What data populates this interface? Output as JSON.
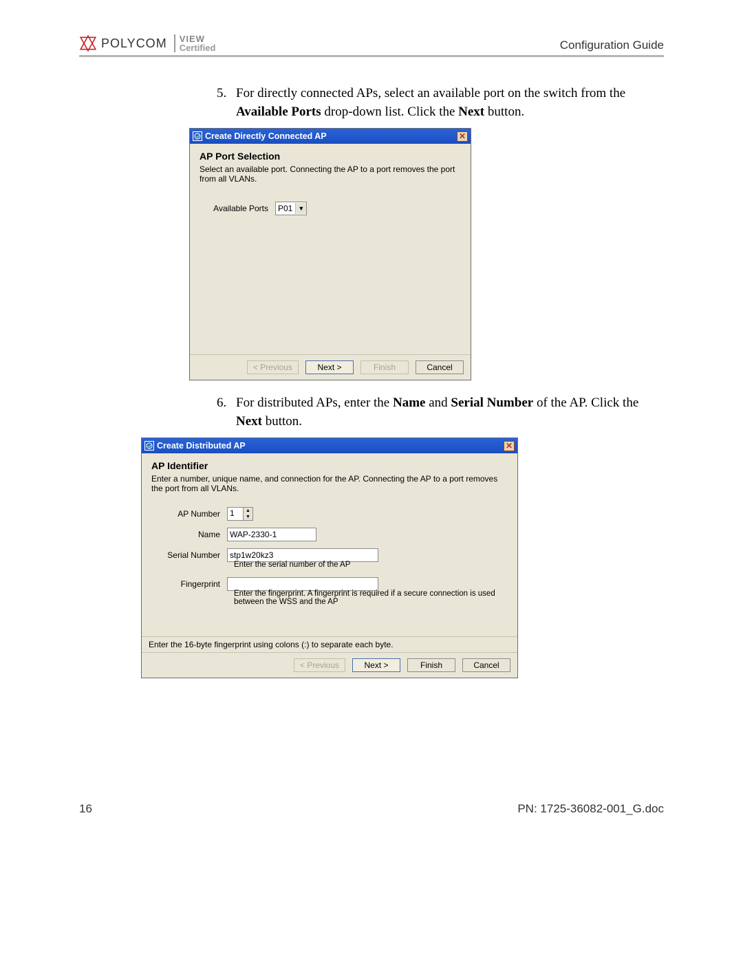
{
  "header": {
    "brand": "POLYCOM",
    "viewL1": "VIEW",
    "viewL2": "Certified",
    "title": "Configuration Guide"
  },
  "steps": {
    "s5": {
      "num": "5.",
      "text_a": "For directly connected APs, select an available port on the switch from the ",
      "bold_a": "Available Ports",
      "text_b": " drop-down list. Click the ",
      "bold_b": "Next",
      "text_c": " button."
    },
    "s6": {
      "num": "6.",
      "text_a": "For distributed APs, enter the ",
      "bold_a": "Name",
      "text_mid": " and ",
      "bold_b": "Serial Number",
      "text_b": " of the AP. Click the ",
      "bold_c": "Next",
      "text_c": " button."
    }
  },
  "dialog1": {
    "title": "Create Directly Connected AP",
    "h1": "AP Port Selection",
    "h2": "Select an available port.  Connecting the AP to a port removes the port from all VLANs.",
    "lbl_ports": "Available Ports",
    "val_ports": "P01",
    "btn_prev": "< Previous",
    "btn_next": "Next >",
    "btn_finish": "Finish",
    "btn_cancel": "Cancel"
  },
  "dialog2": {
    "title": "Create Distributed AP",
    "h1": "AP Identifier",
    "h2": "Enter a number, unique name, and connection for the AP.  Connecting the AP to a port removes the port from all VLANs.",
    "lbl_num": "AP Number",
    "val_num": "1",
    "lbl_name": "Name",
    "val_name": "WAP-2330-1",
    "lbl_serial": "Serial Number",
    "val_serial": "stp1w20kz3",
    "help_serial": "Enter the serial number of the AP",
    "lbl_fp": "Fingerprint",
    "val_fp": "",
    "help_fp": "Enter the fingerprint. A fingerprint is required if a secure connection is used between the WSS and the AP",
    "hint": "Enter the 16-byte fingerprint using colons (:) to separate each byte.",
    "btn_prev": "< Previous",
    "btn_next": "Next >",
    "btn_finish": "Finish",
    "btn_cancel": "Cancel"
  },
  "footer": {
    "pagenum": "16",
    "docid": "PN: 1725-36082-001_G.doc"
  }
}
